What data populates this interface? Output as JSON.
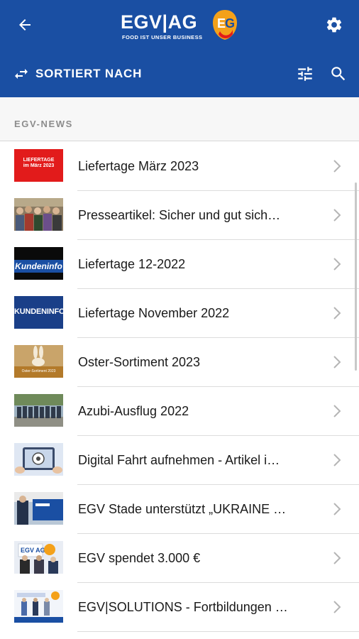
{
  "header": {
    "logo_text": "EGV|AG",
    "logo_tagline": "FOOD IST UNSER BUSINESS",
    "brand_color": "#1a4fa3",
    "accent_color": "#f4a11a"
  },
  "sortbar": {
    "label": "SORTIERT NACH"
  },
  "section": {
    "title": "EGV-NEWS"
  },
  "news": [
    {
      "title": "Liefertage März 2023",
      "thumb_text": "LIEFERTAGE\nim März 2023",
      "thumb_style": "red"
    },
    {
      "title": "Presseartikel: Sicher und gut sich…",
      "thumb_style": "photo-crowd"
    },
    {
      "title": "Liefertage 12-2022",
      "thumb_text": "Kundeninfo",
      "thumb_style": "kunde-black"
    },
    {
      "title": "Liefertage November 2022",
      "thumb_text": "KUNDENINFO",
      "thumb_style": "kunde-blue"
    },
    {
      "title": "Oster-Sortiment 2023",
      "thumb_text": "Oster-Sortiment 2023",
      "thumb_style": "oster"
    },
    {
      "title": "Azubi-Ausflug 2022",
      "thumb_style": "photo-group"
    },
    {
      "title": "Digital Fahrt aufnehmen - Artikel i…",
      "thumb_style": "tablet"
    },
    {
      "title": "EGV Stade unterstützt „UKRAINE …",
      "thumb_style": "photo-blue"
    },
    {
      "title": "EGV spendet 3.000 €",
      "thumb_style": "photo-donation"
    },
    {
      "title": "EGV|SOLUTIONS - Fortbildungen …",
      "thumb_style": "photo-solutions"
    }
  ]
}
